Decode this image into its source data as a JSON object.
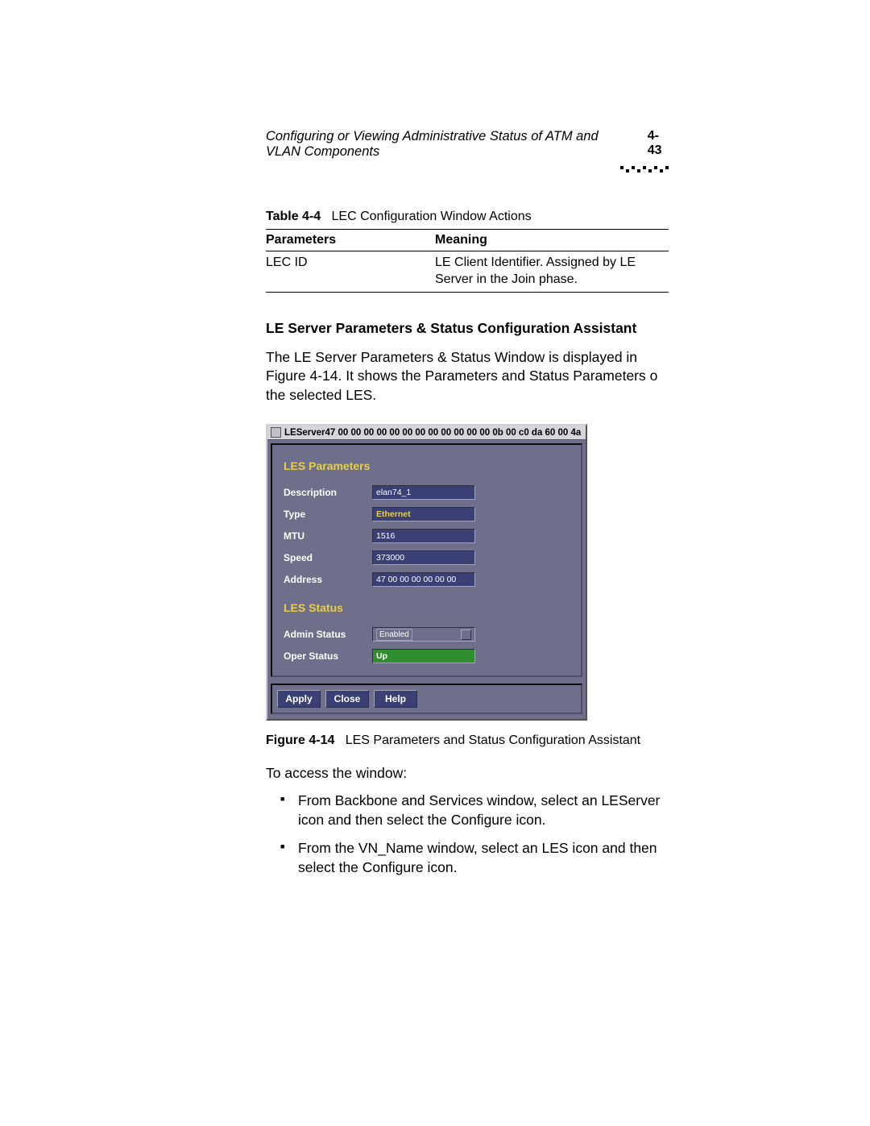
{
  "header": {
    "title": "Configuring or Viewing Administrative Status of ATM and VLAN Components",
    "page_num": "4-43"
  },
  "table_caption": {
    "label": "Table 4-4",
    "text": "LEC Configuration Window Actions"
  },
  "table": {
    "headers": {
      "param": "Parameters",
      "meaning": "Meaning"
    },
    "row": {
      "param": "LEC ID",
      "meaning": "LE Client Identifier. Assigned by LE Server in the Join phase."
    }
  },
  "section_heading": "LE Server Parameters & Status Configuration Assistant",
  "intro_text": "The LE Server Parameters & Status Window is displayed in Figure 4-14. It shows the Parameters and Status Parameters o the selected LES.",
  "les_window": {
    "title": "LEServer47 00 00 00 00 00 00 00 00 00 00 00 00 0b 00 c0 da 60 00 4a",
    "heading_params": "LES Parameters",
    "heading_status": "LES Status",
    "labels": {
      "description": "Description",
      "type": "Type",
      "mtu": "MTU",
      "speed": "Speed",
      "address": "Address",
      "admin": "Admin Status",
      "oper": "Oper Status"
    },
    "values": {
      "description": "elan74_1",
      "type": "Ethernet",
      "mtu": "1516",
      "speed": "373000",
      "address": "47 00 00 00 00 00 00",
      "admin": "Enabled",
      "oper": "Up"
    },
    "buttons": {
      "apply": "Apply",
      "close": "Close",
      "help": "Help"
    }
  },
  "figure_caption": {
    "label": "Figure 4-14",
    "text": "LES Parameters and Status Configuration Assistant"
  },
  "access_text": "To access the window:",
  "bullets": [
    "From Backbone and Services window, select an LEServer icon and then select the Configure icon.",
    "From the VN_Name window, select an LES icon and then select the Configure icon."
  ]
}
